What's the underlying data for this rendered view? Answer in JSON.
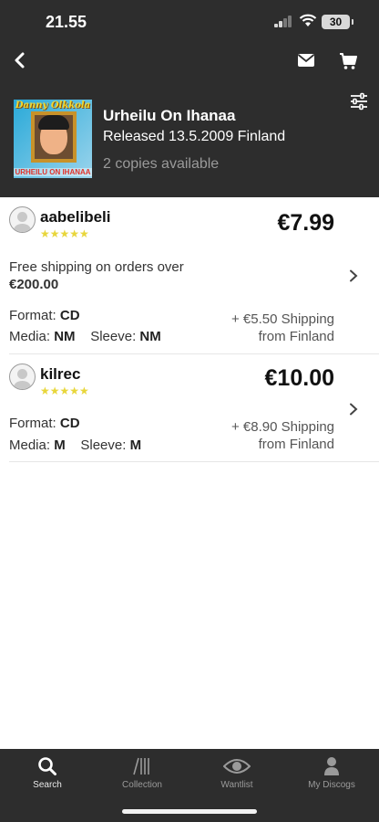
{
  "status": {
    "time": "21.55",
    "battery": "30"
  },
  "header": {
    "back_icon": "chevron-left-icon",
    "mail_icon": "envelope-icon",
    "cart_icon": "cart-icon",
    "filter_icon": "sliders-icon"
  },
  "release": {
    "cover_artist": "Danny Olkkola",
    "cover_album": "URHEILU ON IHANAA",
    "title": "Urheilu On Ihanaa",
    "released": "Released 13.5.2009 Finland",
    "copies": "2 copies available"
  },
  "listings": [
    {
      "seller": "aabelibeli",
      "stars": "★★★★★",
      "rating": 4.5,
      "price": "€7.99",
      "note_prefix": "Free shipping on orders over",
      "note_amount": "€200.00",
      "format_label": "Format:",
      "format": "CD",
      "media_label": "Media:",
      "media": "NM",
      "sleeve_label": "Sleeve:",
      "sleeve": "NM",
      "shipping": "+ €5.50 Shipping",
      "from": "from Finland"
    },
    {
      "seller": "kilrec",
      "stars": "★★★★★",
      "rating": 4.5,
      "price": "€10.00",
      "format_label": "Format:",
      "format": "CD",
      "media_label": "Media:",
      "media": "M",
      "sleeve_label": "Sleeve:",
      "sleeve": "M",
      "shipping": "+ €8.90 Shipping",
      "from": "from Finland"
    }
  ],
  "tabs": [
    {
      "label": "Search",
      "icon": "search-icon",
      "active": true
    },
    {
      "label": "Collection",
      "icon": "collection-icon",
      "active": false
    },
    {
      "label": "Wantlist",
      "icon": "eye-icon",
      "active": false
    },
    {
      "label": "My Discogs",
      "icon": "user-icon",
      "active": false
    }
  ],
  "colors": {
    "header_bg": "#2d2d2d",
    "star": "#e8d63b",
    "background": "#ffffff"
  }
}
